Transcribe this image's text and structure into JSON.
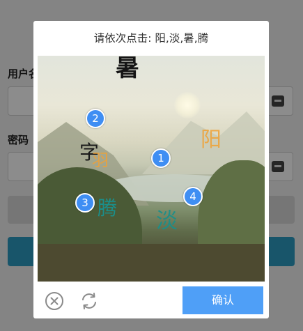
{
  "background_form": {
    "username_label": "用户名",
    "password_label": "密码"
  },
  "captcha": {
    "title": "请依次点击: 阳,淡,暑,腾",
    "image_caption": " ",
    "characters": [
      {
        "text": "暑",
        "color": "#151515"
      },
      {
        "text": "阳",
        "color": "#f0a236"
      },
      {
        "text": "字",
        "color": "#1a1a1a"
      },
      {
        "text": "羽",
        "color": "#f0a236"
      },
      {
        "text": "腾",
        "color": "#1a8f8b"
      },
      {
        "text": "淡",
        "color": "#1a8f8b"
      }
    ],
    "markers": [
      "1",
      "2",
      "3",
      "4"
    ],
    "close_icon": "close-circle-icon",
    "refresh_icon": "refresh-icon",
    "confirm_label": "确认",
    "accent_color": "#4f9ff7"
  }
}
